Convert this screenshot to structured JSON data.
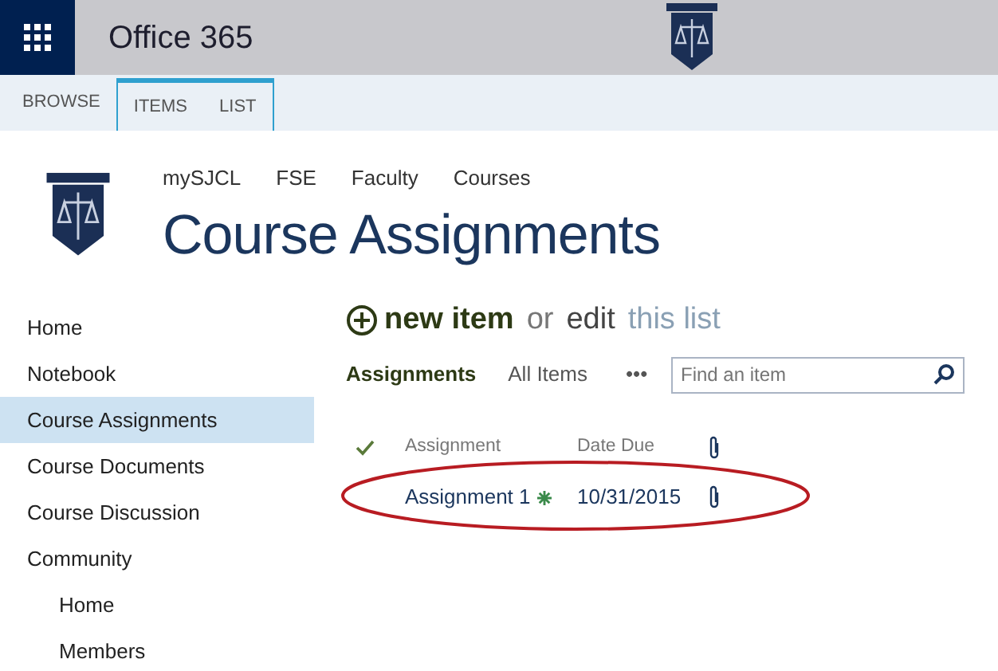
{
  "suite_bar": {
    "app_name": "Office 365"
  },
  "ribbon_tabs": [
    {
      "label": "BROWSE",
      "contextual": false
    },
    {
      "label": "ITEMS",
      "contextual": true
    },
    {
      "label": "LIST",
      "contextual": true
    }
  ],
  "breadcrumbs": [
    "mySJCL",
    "FSE",
    "Faculty",
    "Courses"
  ],
  "page_title": "Course Assignments",
  "sidebar": {
    "items": [
      {
        "label": "Home",
        "selected": false
      },
      {
        "label": "Notebook",
        "selected": false
      },
      {
        "label": "Course Assignments",
        "selected": true
      },
      {
        "label": "Course Documents",
        "selected": false
      },
      {
        "label": "Course Discussion",
        "selected": false
      },
      {
        "label": "Community",
        "selected": false,
        "children": [
          {
            "label": "Home",
            "selected": false
          },
          {
            "label": "Members",
            "selected": false
          }
        ]
      }
    ]
  },
  "new_item_bar": {
    "new_item": "new item",
    "or": "or",
    "edit": "edit",
    "this_list": "this list"
  },
  "views": [
    {
      "label": "Assignments",
      "selected": true
    },
    {
      "label": "All Items",
      "selected": false
    }
  ],
  "more_views": "•••",
  "search": {
    "placeholder": "Find an item"
  },
  "table": {
    "columns": [
      "Assignment",
      "Date Due"
    ],
    "rows": [
      {
        "cells": [
          "Assignment 1",
          "10/31/2015"
        ],
        "new": true,
        "attachment": true,
        "highlighted": true
      }
    ]
  }
}
